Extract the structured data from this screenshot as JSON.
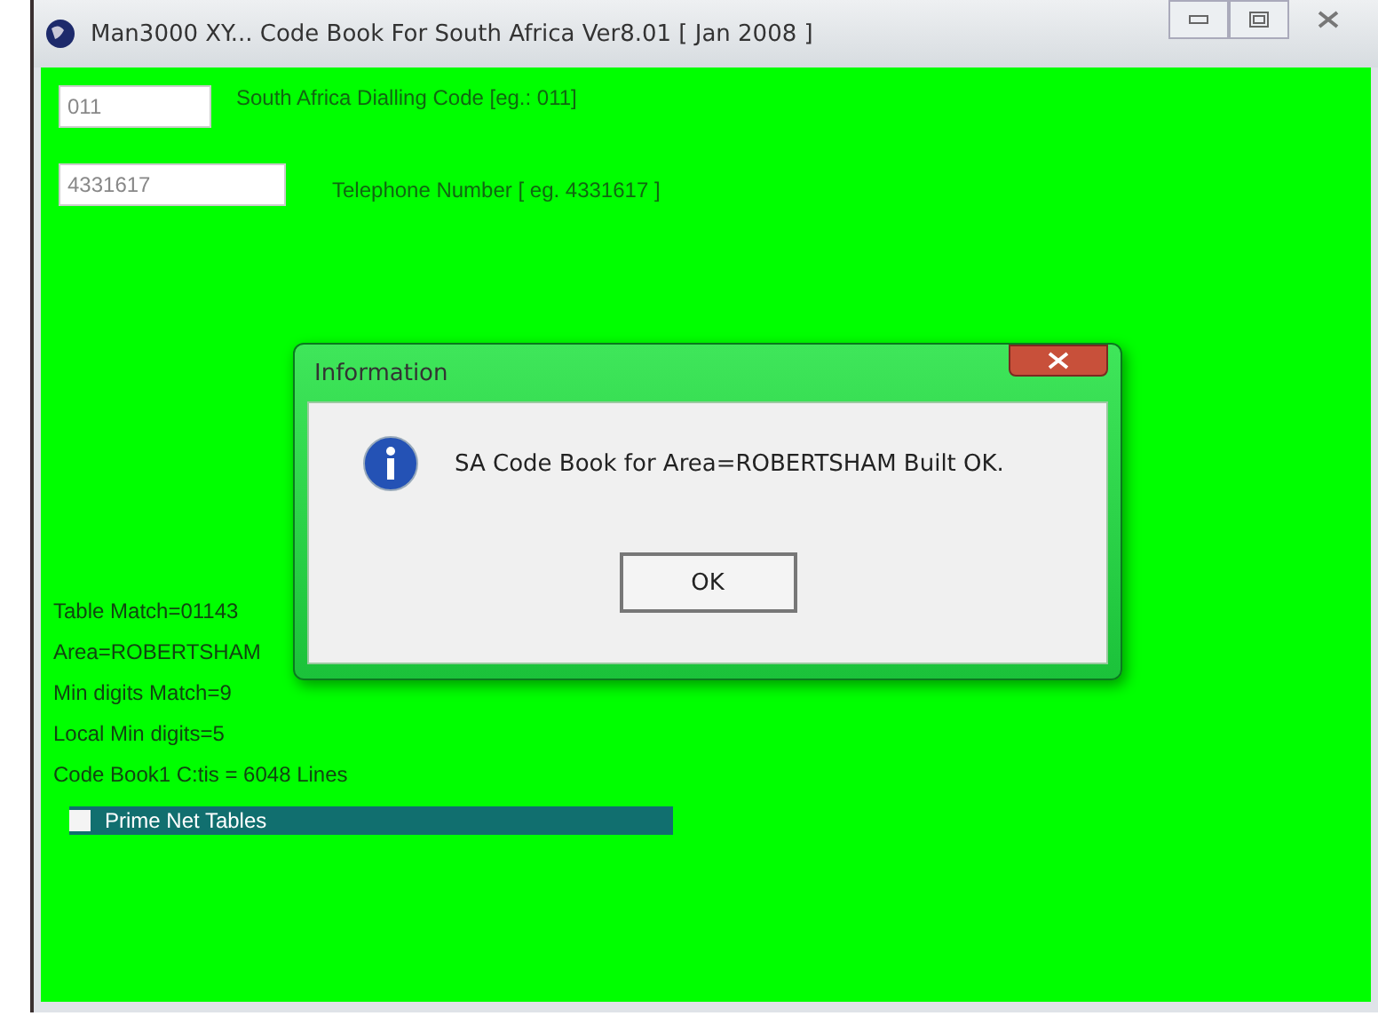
{
  "window": {
    "title": "Man3000 XY...  Code Book For South Africa  Ver8.01 [ Jan 2008 ]"
  },
  "fields": [
    {
      "value": "011",
      "label": "South Africa Dialling Code [eg.: 011]"
    },
    {
      "value": "4331617",
      "label": "Telephone Number [ eg. 4331617 ]"
    }
  ],
  "status_lines": [
    "Table Match=01143",
    "Area=ROBERTSHAM",
    "Min digits Match=9",
    "Local Min digits=5",
    "Code Book1   C:tis = 6048 Lines"
  ],
  "option": {
    "label": "Prime Net Tables",
    "checked": false
  },
  "dialog": {
    "title": "Information",
    "message": "SA Code Book for Area=ROBERTSHAM Built OK.",
    "button": "OK"
  }
}
